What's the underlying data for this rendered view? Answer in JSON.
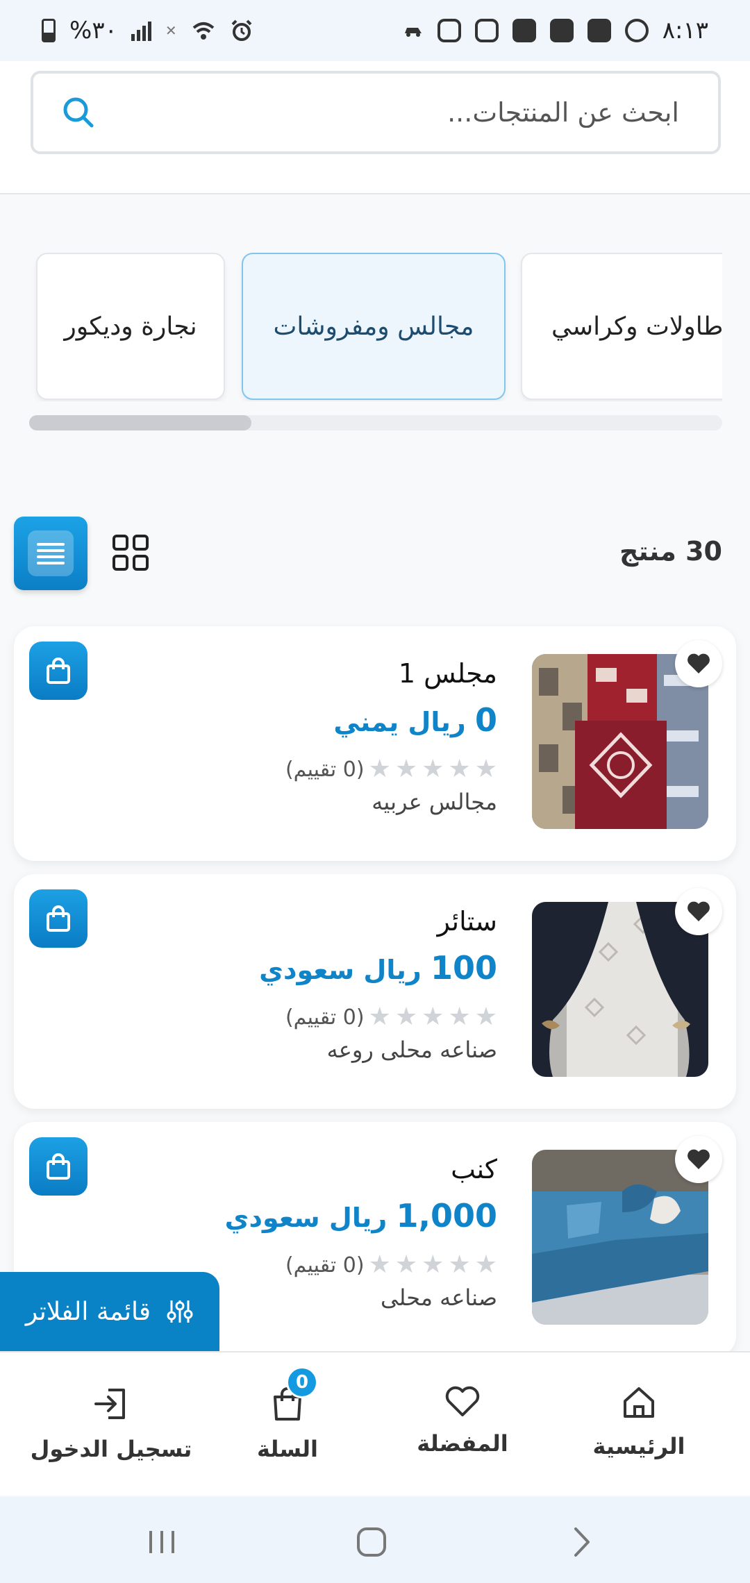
{
  "status_bar": {
    "time": "٨:١٣",
    "battery": "%٣٠"
  },
  "search": {
    "placeholder": "ابحث عن المنتجات..."
  },
  "categories": [
    {
      "label": "نجارة وديكور"
    },
    {
      "label": "مجالس ومفروشات"
    },
    {
      "label": "طاولات وكراسي"
    }
  ],
  "results": {
    "count_label": "30 منتج"
  },
  "products": [
    {
      "name": "مجلس 1",
      "price": "0",
      "currency": "ريال يمني",
      "rating_text": "(0 تقييم)",
      "seller": "مجالس عربيه"
    },
    {
      "name": "ستائر",
      "price": "100",
      "currency": "ريال سعودي",
      "rating_text": "(0 تقييم)",
      "seller": "صناعه محلى روعه"
    },
    {
      "name": "كنب",
      "price": "1,000",
      "currency": "ريال سعودي",
      "rating_text": "(0 تقييم)",
      "seller": "صناعه محلى"
    }
  ],
  "filter": {
    "label": "قائمة الفلاتر"
  },
  "bottom_nav": {
    "home": "الرئيسية",
    "favorites": "المفضلة",
    "cart": "السلة",
    "cart_count": "0",
    "login": "تسجيل الدخول"
  },
  "colors": {
    "accent": "#0a82c6",
    "accent_light": "#1da0e4",
    "price": "#1084c8",
    "active_category_bg": "#eef6fd",
    "active_category_border": "#7fc6ef"
  }
}
